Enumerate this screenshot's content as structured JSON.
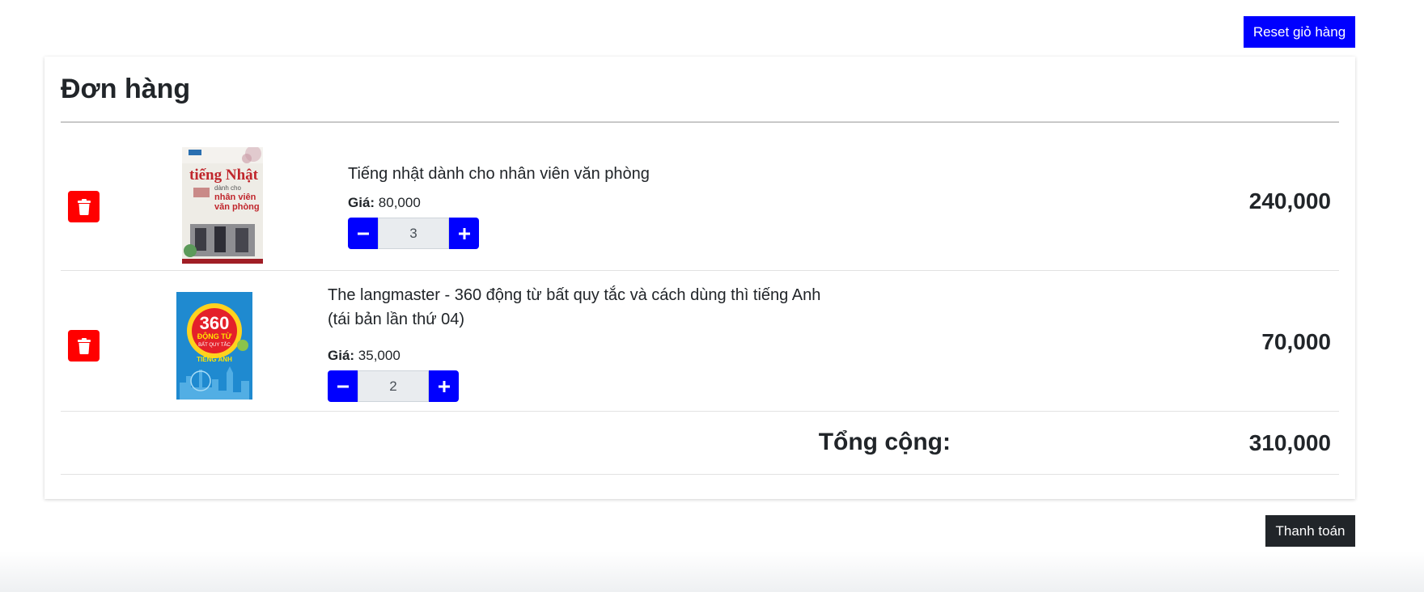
{
  "header": {
    "reset_label": "Reset giỏ hàng"
  },
  "cart": {
    "title": "Đơn hàng",
    "price_label": "Giá:",
    "items": [
      {
        "name": "Tiếng nhật dành cho nhân viên văn phòng",
        "price": "80,000",
        "quantity": "3",
        "line_total": "240,000",
        "cover_text_1": "tiếng Nhật",
        "cover_text_2": "dành cho",
        "cover_text_3": "nhân viên",
        "cover_text_4": "văn phòng"
      },
      {
        "name": "The langmaster - 360 động từ bất quy tắc và cách dùng thì tiếng Anh (tái bản lần thứ 04)",
        "price": "35,000",
        "quantity": "2",
        "line_total": "70,000",
        "cover_text_1": "360",
        "cover_text_2": "ĐỘNG TỪ",
        "cover_text_3": "BẤT QUY TẮC",
        "cover_text_4": "TIẾNG ANH"
      }
    ],
    "total_label": "Tổng cộng:",
    "total_value": "310,000"
  },
  "footer": {
    "checkout_label": "Thanh toán"
  },
  "colors": {
    "primary": "#0000ff",
    "danger": "#ff0000",
    "dark": "#212529"
  },
  "icons": {
    "delete": "trash-icon",
    "decrement": "minus-icon",
    "increment": "plus-icon"
  }
}
